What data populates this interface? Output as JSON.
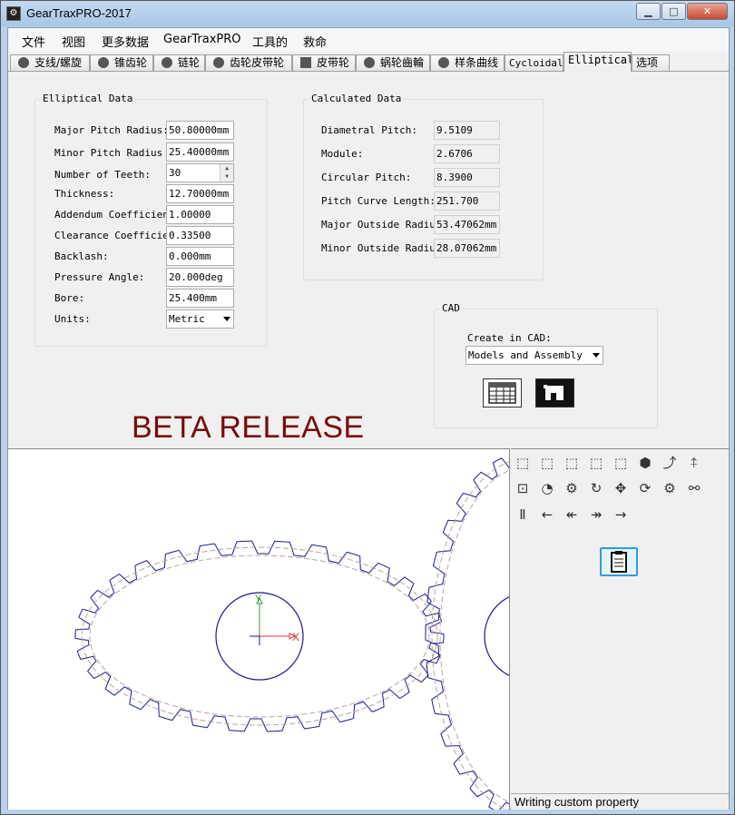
{
  "window": {
    "title": "GearTraxPRO-2017"
  },
  "menu": [
    "文件",
    "视图",
    "更多数据",
    "GearTraxPRO",
    "工具的",
    "救命"
  ],
  "tabs": [
    "支线/螺旋",
    "锥齿轮",
    "链轮",
    "齿轮皮带轮",
    "皮带轮",
    "蜗轮齒輪",
    "样条曲线",
    "Cycloidal",
    "Elliptical",
    "选项"
  ],
  "active_tab": "Elliptical",
  "elliptical_data": {
    "title": "Elliptical Data",
    "rows": [
      {
        "label": "Major Pitch Radius:",
        "value": "50.80000mm"
      },
      {
        "label": "Minor Pitch Radius",
        "value": "25.40000mm"
      },
      {
        "label": "Number of Teeth:",
        "value": "30"
      },
      {
        "label": "Thickness:",
        "value": "12.70000mm"
      },
      {
        "label": "Addendum Coefficient:",
        "value": "1.00000"
      },
      {
        "label": "Clearance Coefficient:",
        "value": "0.33500"
      },
      {
        "label": "Backlash:",
        "value": "0.000mm"
      },
      {
        "label": "Pressure Angle:",
        "value": "20.000deg"
      },
      {
        "label": "Bore:",
        "value": "25.400mm"
      },
      {
        "label": "Units:",
        "value": "Metric"
      }
    ]
  },
  "calculated_data": {
    "title": "Calculated Data",
    "rows": [
      {
        "label": "Diametral Pitch:",
        "value": "9.5109"
      },
      {
        "label": "Module:",
        "value": "2.6706"
      },
      {
        "label": "Circular Pitch:",
        "value": "8.3900"
      },
      {
        "label": "Pitch Curve Length:",
        "value": "251.700"
      },
      {
        "label": "Major Outside Radius:",
        "value": "53.47062mm"
      },
      {
        "label": "Minor Outside Radius:",
        "value": "28.07062mm"
      }
    ]
  },
  "cad": {
    "title": "CAD",
    "create_label": "Create in CAD:",
    "create_value": "Models and Assembly"
  },
  "beta_text": "BETA RELEASE",
  "viewport": {
    "axis_x": "X",
    "axis_y": "Y"
  },
  "status": "Writing custom property",
  "colors": {
    "gear_line": "#1a1a8c",
    "pitch_dash": "#c0a0a0",
    "axis_x": "#e03030",
    "axis_y": "#20a020",
    "beta": "#7a0a0a"
  },
  "icons": {
    "row1": [
      "cube-front-icon",
      "cube-top-icon",
      "cube-right-icon",
      "cube-left-icon",
      "cube-back-icon",
      "cube-shaded-icon",
      "rotate-tilt-icon",
      "plane-up-icon"
    ],
    "row2": [
      "zoom-fit-icon",
      "zoom-area-icon",
      "zoom-gear-icon",
      "rotate-gear-icon",
      "pan-icon",
      "spin-gear-icon",
      "mesh-gears-icon",
      "split-gears-icon"
    ],
    "row3": [
      "pause-icon",
      "step-back-icon",
      "fast-back-icon",
      "fast-forward-icon",
      "step-forward-icon"
    ]
  }
}
